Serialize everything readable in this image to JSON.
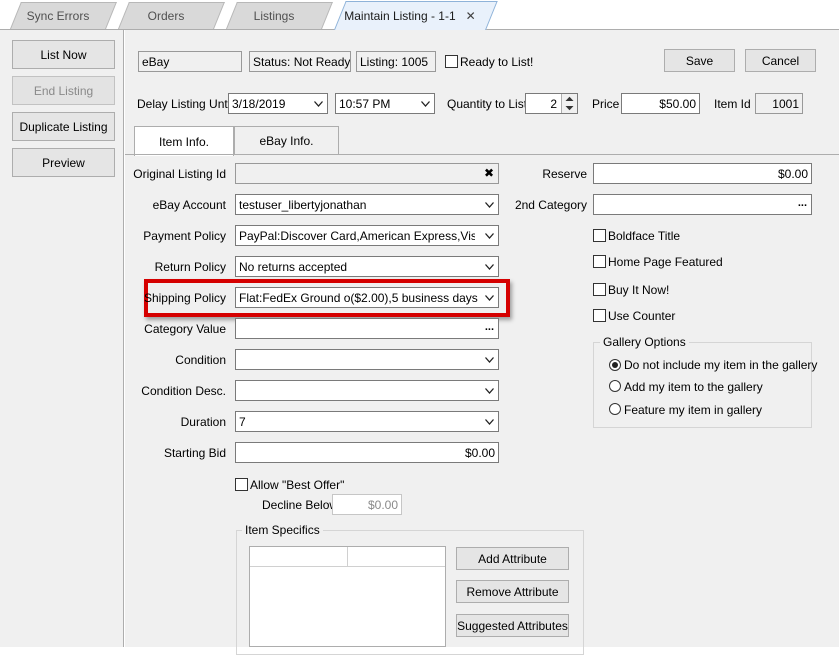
{
  "tabs": [
    {
      "label": "Sync Errors"
    },
    {
      "label": "Orders"
    },
    {
      "label": "Listings"
    },
    {
      "label": "Maintain Listing - 1-1",
      "close": "✕"
    }
  ],
  "left_buttons": {
    "list_now": "List Now",
    "end_listing": "End Listing",
    "duplicate_listing": "Duplicate Listing",
    "preview": "Preview"
  },
  "header": {
    "site": "eBay",
    "status": "Status: Not Ready",
    "listing": "Listing: 1005",
    "ready_label": "Ready to List!",
    "ready_checked": false,
    "save": "Save",
    "cancel": "Cancel",
    "delay_label": "Delay Listing Until",
    "delay_date": "3/18/2019",
    "delay_time": "10:57 PM",
    "qty_label": "Quantity to List",
    "qty_value": "2",
    "price_label": "Price",
    "price_value": "$50.00",
    "item_id_label": "Item Id",
    "item_id_value": "1001"
  },
  "inner_tabs": {
    "item_info": "Item Info.",
    "ebay_info": "eBay Info."
  },
  "form": {
    "original_listing_id_label": "Original Listing Id",
    "original_listing_id_value": "",
    "clear_glyph": "✖",
    "ebay_account_label": "eBay Account",
    "ebay_account_value": "testuser_libertyjonathan",
    "payment_policy_label": "Payment Policy",
    "payment_policy_value": "PayPal:Discover Card,American Express,Visa or",
    "return_policy_label": "Return Policy",
    "return_policy_value": "No returns accepted",
    "shipping_policy_label": "Shipping Policy",
    "shipping_policy_value": "Flat:FedEx Ground o($2.00),5 business days",
    "category_value_label": "Category Value",
    "category_value_value": "",
    "ellipsis": "...",
    "condition_label": "Condition",
    "condition_value": "",
    "condition_desc_label": "Condition Desc.",
    "condition_desc_value": "",
    "duration_label": "Duration",
    "duration_value": "7",
    "starting_bid_label": "Starting Bid",
    "starting_bid_value": "$0.00",
    "allow_best_offer_label": "Allow \"Best Offer\"",
    "decline_below_label": "Decline Below",
    "decline_below_value": "$0.00",
    "item_specifics_label": "Item Specifics",
    "add_attribute": "Add Attribute",
    "remove_attribute": "Remove Attribute",
    "suggested_attributes": "Suggested Attributes"
  },
  "right": {
    "reserve_label": "Reserve",
    "reserve_value": "$0.00",
    "second_category_label": "2nd Category",
    "second_category_value": "",
    "boldface_title": "Boldface Title",
    "home_page_featured": "Home Page Featured",
    "buy_it_now": "Buy It Now!",
    "use_counter": "Use Counter",
    "gallery_options_label": "Gallery Options",
    "gallery_opt1": "Do not include my item in the gallery",
    "gallery_opt2": "Add my item to the gallery",
    "gallery_opt3": "Feature my item in gallery"
  },
  "colors": {
    "highlight": "#d50000",
    "panel": "#f0f0f0",
    "active_tab": "#e9f1fb"
  }
}
